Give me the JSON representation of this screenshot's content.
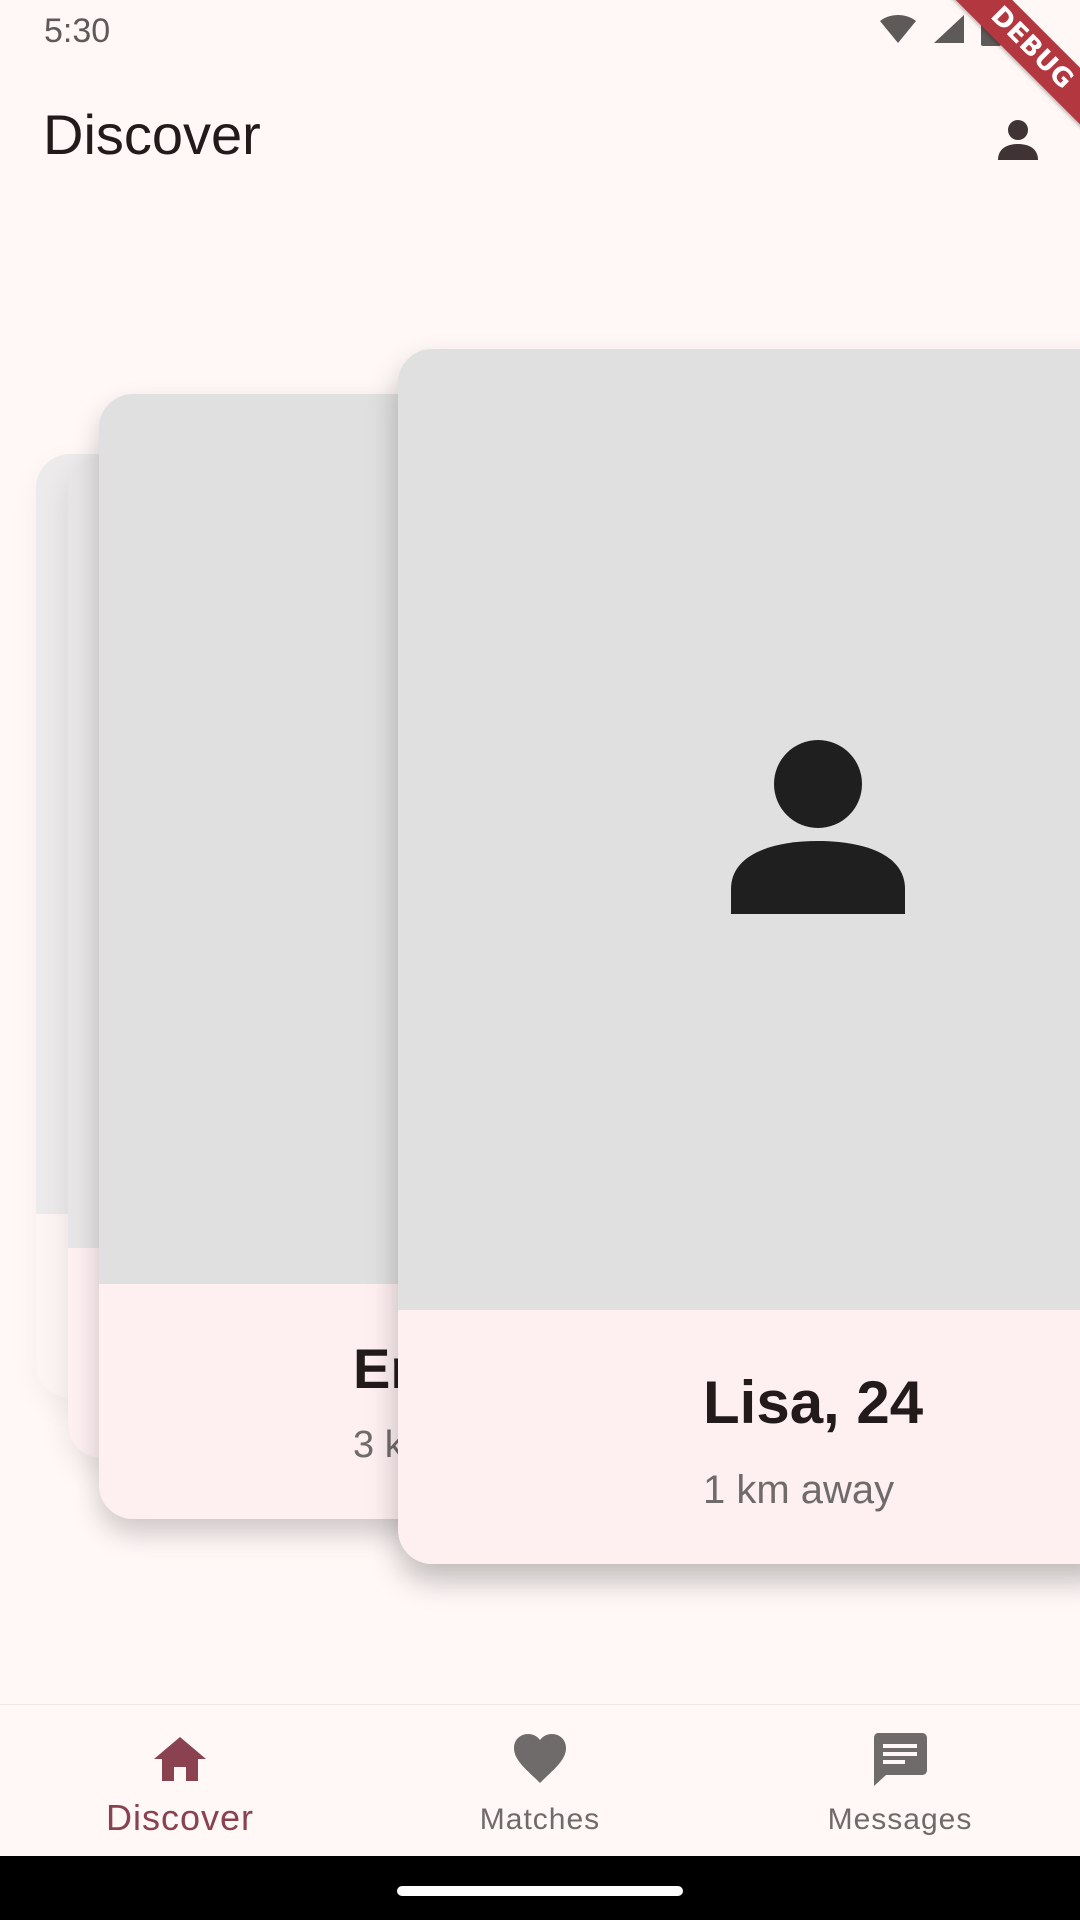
{
  "status_bar": {
    "time": "5:30",
    "icons": [
      "wifi-icon",
      "signal-icon",
      "battery-icon"
    ]
  },
  "debug_banner": {
    "label": "DEBUG",
    "color": "#B2373E"
  },
  "app_bar": {
    "title": "Discover",
    "profile_icon": "person-icon"
  },
  "cards": {
    "front": {
      "name": "Lisa, 24",
      "distance": "1 km away",
      "photo_icon": "person-placeholder-icon"
    },
    "middle": {
      "name": "Em",
      "distance": "3 km away"
    }
  },
  "bottom_nav": {
    "items": [
      {
        "label": "Discover",
        "icon": "home-icon",
        "active": true
      },
      {
        "label": "Matches",
        "icon": "heart-icon",
        "active": false
      },
      {
        "label": "Messages",
        "icon": "chat-icon",
        "active": false
      }
    ]
  },
  "colors": {
    "background": "#FFF8F7",
    "accent": "#8A4150",
    "card_info_bg": "#FEF0F1",
    "photo_placeholder": "#E0E0E0",
    "inactive": "#6F6B6B"
  }
}
